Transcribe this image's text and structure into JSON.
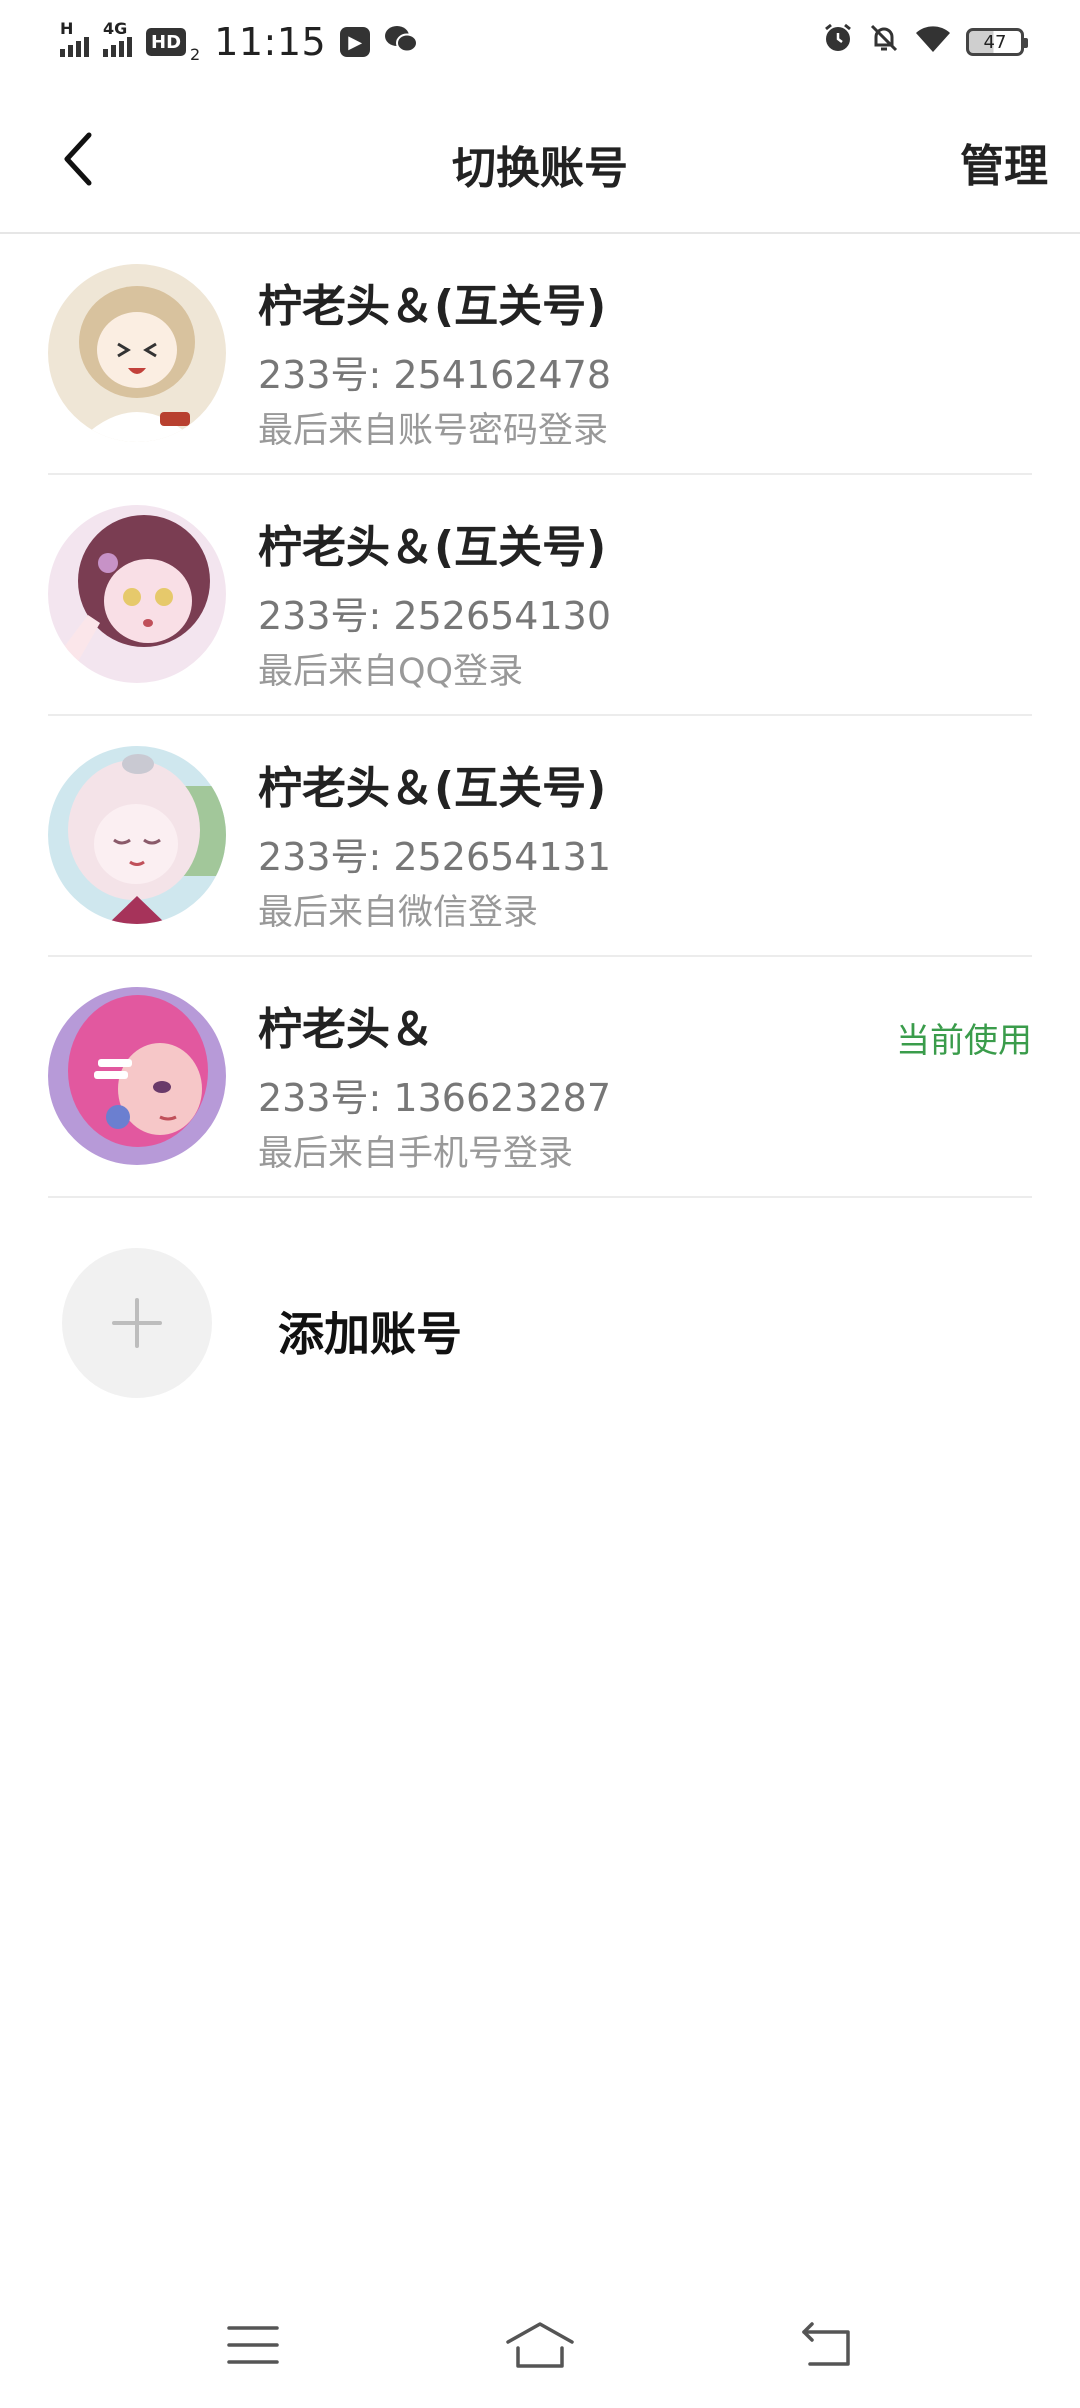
{
  "status_bar": {
    "signal1_label": "H",
    "signal2_label": "4G",
    "hd_label": "HD",
    "hd_sub": "2",
    "time": "11:15",
    "battery": "47"
  },
  "header": {
    "title": "切换账号",
    "manage_label": "管理"
  },
  "accounts": [
    {
      "name": "柠老头＆(互关号)",
      "id_text": "233号: 254162478",
      "login_text": "最后来自账号密码登录",
      "current_label": "",
      "avatar_colors": [
        "#efe6d6",
        "#d8c29e",
        "#ffffff",
        "#b8402f"
      ]
    },
    {
      "name": "柠老头＆(互关号)",
      "id_text": "233号: 252654130",
      "login_text": "最后来自QQ登录",
      "current_label": "",
      "avatar_colors": [
        "#f3e5ef",
        "#7a3d52",
        "#f9dfe6",
        "#c792c7"
      ]
    },
    {
      "name": "柠老头＆(互关号)",
      "id_text": "233号: 252654131",
      "login_text": "最后来自微信登录",
      "current_label": "",
      "avatar_colors": [
        "#cfe7ee",
        "#f4e3e8",
        "#fbeff2",
        "#a2c79a"
      ]
    },
    {
      "name": "柠老头＆",
      "id_text": "233号: 136623287",
      "login_text": "最后来自手机号登录",
      "current_label": "当前使用",
      "avatar_colors": [
        "#b79ad8",
        "#e2589f",
        "#f6c7c8",
        "#6b7fd0"
      ]
    }
  ],
  "add_account": {
    "label": "添加账号"
  },
  "colors": {
    "accent_green": "#3a9c4b",
    "divider": "#ececec"
  }
}
